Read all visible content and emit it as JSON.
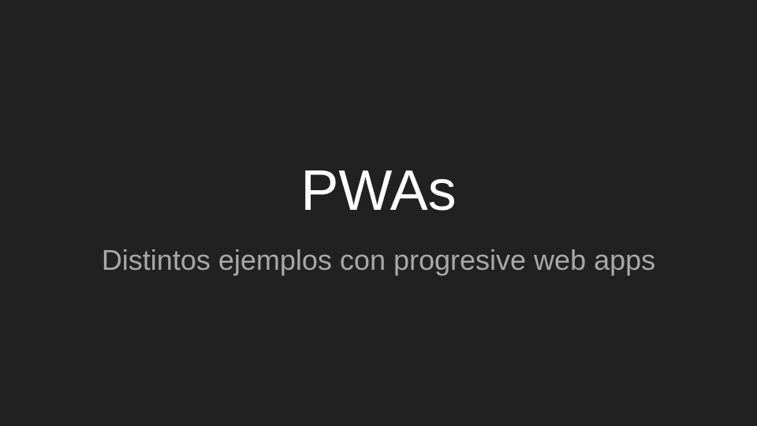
{
  "slide": {
    "title": "PWAs",
    "subtitle": "Distintos ejemplos con progresive web apps"
  },
  "colors": {
    "background": "#212121",
    "title": "#ffffff",
    "subtitle": "#a8a8a8"
  }
}
